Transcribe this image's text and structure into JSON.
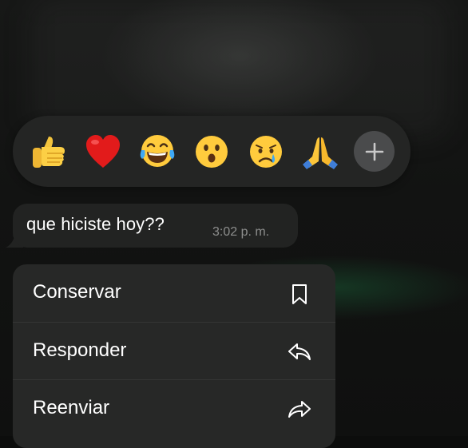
{
  "reactions": {
    "emojis": [
      {
        "icon": "thumbs-up-icon"
      },
      {
        "icon": "red-heart-icon"
      },
      {
        "icon": "tears-of-joy-icon"
      },
      {
        "icon": "surprised-face-icon"
      },
      {
        "icon": "crying-face-icon"
      },
      {
        "icon": "folded-hands-icon"
      }
    ],
    "more_icon": "plus-icon"
  },
  "message": {
    "text": "que hiciste hoy??",
    "time": "3:02 p. m."
  },
  "context_menu": {
    "items": [
      {
        "label": "Conservar",
        "icon": "bookmark-icon"
      },
      {
        "label": "Responder",
        "icon": "reply-icon"
      },
      {
        "label": "Reenviar",
        "icon": "forward-icon"
      }
    ]
  },
  "colors": {
    "background": "#0c0d0c",
    "surface": "#242524",
    "bubble": "#222322",
    "menu": "#272827",
    "text": "#ffffff",
    "muted_text": "#8d8e8d",
    "plus_button": "#4a4b4c"
  }
}
